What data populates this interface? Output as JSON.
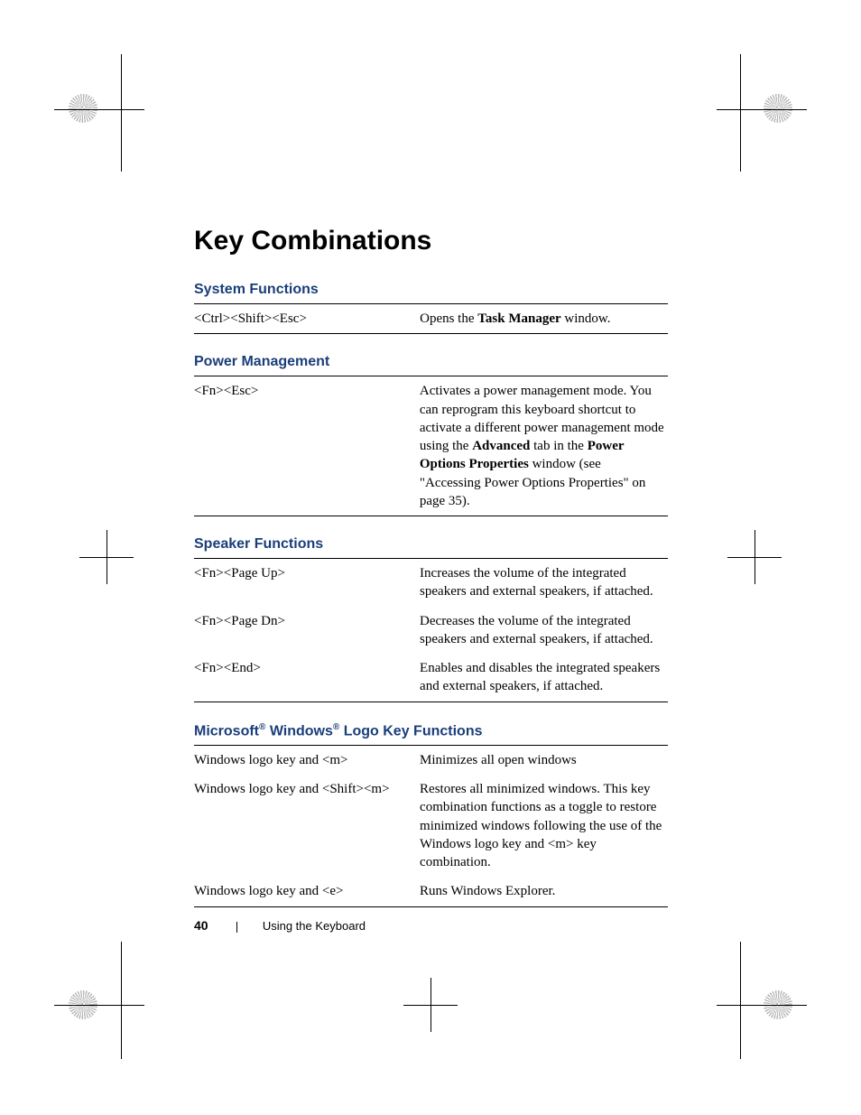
{
  "title": "Key Combinations",
  "sections": [
    {
      "heading": "System Functions",
      "heading_html": "System Functions",
      "rows": [
        {
          "key": "<Ctrl><Shift><Esc>",
          "desc_html": "Opens the <b>Task Manager</b> window."
        }
      ]
    },
    {
      "heading": "Power Management",
      "heading_html": "Power Management",
      "rows": [
        {
          "key": "<Fn><Esc>",
          "desc_html": "Activates a power management mode. You can reprogram this keyboard shortcut to activate a different power management mode using the <b>Advanced</b> tab in the <b>Power Options Properties</b> window (see \"Accessing Power Options Properties\" on page 35)."
        }
      ]
    },
    {
      "heading": "Speaker Functions",
      "heading_html": "Speaker Functions",
      "rows": [
        {
          "key": "<Fn><Page Up>",
          "desc_html": "Increases the volume of the integrated speakers and external speakers, if attached."
        },
        {
          "key": "<Fn><Page Dn>",
          "desc_html": "Decreases the volume of the integrated speakers and external speakers, if attached."
        },
        {
          "key": "<Fn><End>",
          "desc_html": "Enables and disables the integrated speakers and external speakers, if attached."
        }
      ]
    },
    {
      "heading": "Microsoft Windows Logo Key Functions",
      "heading_html": "Microsoft<sup>®</sup> Windows<sup>®</sup> Logo Key Functions",
      "rows": [
        {
          "key": "Windows logo key and <m>",
          "desc_html": "Minimizes all open windows"
        },
        {
          "key": "Windows logo key and <Shift><m>",
          "desc_html": "Restores all minimized windows. This key combination functions as a toggle to restore minimized windows following the use of the Windows logo key and &lt;m&gt; key combination."
        },
        {
          "key": "Windows logo key and <e>",
          "desc_html": "Runs Windows Explorer."
        }
      ]
    }
  ],
  "footer": {
    "page_number": "40",
    "section_name": "Using the Keyboard"
  }
}
